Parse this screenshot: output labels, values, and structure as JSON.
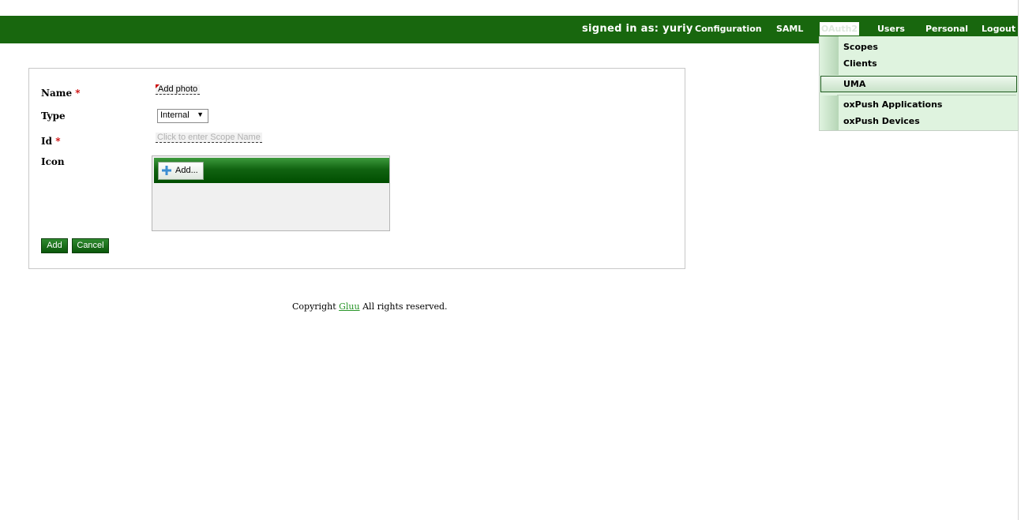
{
  "header": {
    "signed_in": "signed in as: yuriy",
    "nav": {
      "configuration": "Configuration",
      "saml": "SAML",
      "oauth2": "OAuth2",
      "users": "Users",
      "personal": "Personal",
      "logout": "Logout"
    }
  },
  "oauth_menu": {
    "items": [
      "Scopes",
      "Clients",
      "UMA",
      "oxPush Applications",
      "oxPush Devices"
    ],
    "highlighted": "UMA"
  },
  "form": {
    "name": {
      "label": "Name",
      "required_marker": "*",
      "value": "Add photo"
    },
    "type": {
      "label": "Type",
      "selected": "Internal",
      "arrow": "▼"
    },
    "id": {
      "label": "Id",
      "required_marker": "*",
      "placeholder": "Click to enter Scope Name"
    },
    "icon": {
      "label": "Icon",
      "add_button": "Add..."
    },
    "buttons": {
      "add": "Add",
      "cancel": "Cancel"
    }
  },
  "footer": {
    "prefix": "Copyright",
    "link": "Gluu",
    "suffix": "All rights reserved."
  },
  "colors": {
    "brand_green": "#18670e",
    "menu_bg": "#dff3df",
    "link_green": "#2a962a",
    "required_red": "#cc0000"
  },
  "icons": {
    "upload_add": "plus-icon",
    "select_arrow": "chevron-down-icon"
  }
}
